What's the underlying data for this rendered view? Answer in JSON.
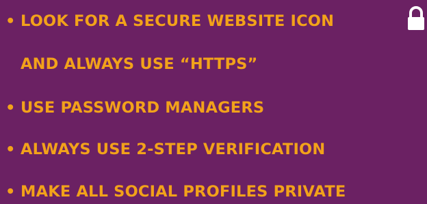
{
  "bullet_glyph": "•",
  "items": [
    {
      "text": "LOOK FOR A SECURE WEBSITE ICON",
      "bulleted": true
    },
    {
      "text": "AND ALWAYS USE “HTTPS”",
      "bulleted": false
    },
    {
      "text": "USE PASSWORD MANAGERS",
      "bulleted": true
    },
    {
      "text": "ALWAYS USE 2-STEP VERIFICATION",
      "bulleted": true
    },
    {
      "text": "MAKE ALL SOCIAL PROFILES PRIVATE",
      "bulleted": true
    }
  ],
  "icons": {
    "lock": "lock-icon"
  },
  "colors": {
    "background": "#6b2163",
    "text": "#f2a21a",
    "icon": "#ffffff"
  }
}
